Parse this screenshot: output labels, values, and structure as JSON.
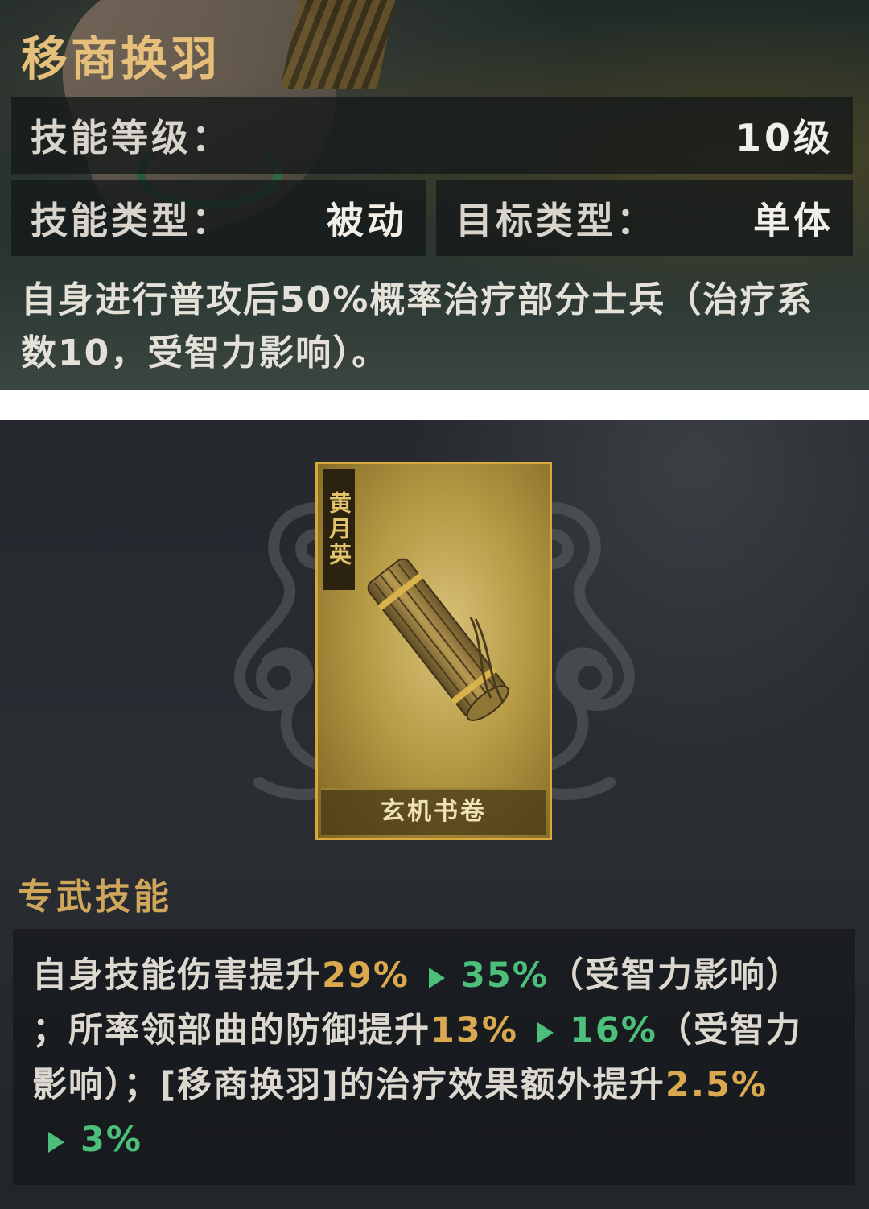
{
  "skill": {
    "title": "移商换羽",
    "level_label": "技能等级：",
    "level_value": "10级",
    "type_label": "技能类型：",
    "type_value": "被动",
    "target_label": "目标类型：",
    "target_value": "单体",
    "description": "自身进行普攻后50%概率治疗部分士兵（治疗系数10，受智力影响）。"
  },
  "card": {
    "owner": "黄月英",
    "name": "玄机书卷"
  },
  "exclusive": {
    "title": "专武技能",
    "part1": "自身技能伤害提升",
    "v1_from": "29%",
    "v1_to": "35%",
    "part2": "（受智力影响）",
    "part3": "；所率领部曲的防御提升",
    "v2_from": "13%",
    "v2_to": "16%",
    "part4": "（受智力影响）；[移商换羽]的治疗效果额外提升",
    "v3_from": "2.5%",
    "v3_to": "3%"
  },
  "colors": {
    "title_gold": "#e6c07a",
    "old_value": "#d9a84f",
    "new_value": "#4cc07a"
  },
  "icons": [
    "scroll-icon",
    "dragon-ornament-left",
    "dragon-ornament-right",
    "arrow-right-icon"
  ]
}
